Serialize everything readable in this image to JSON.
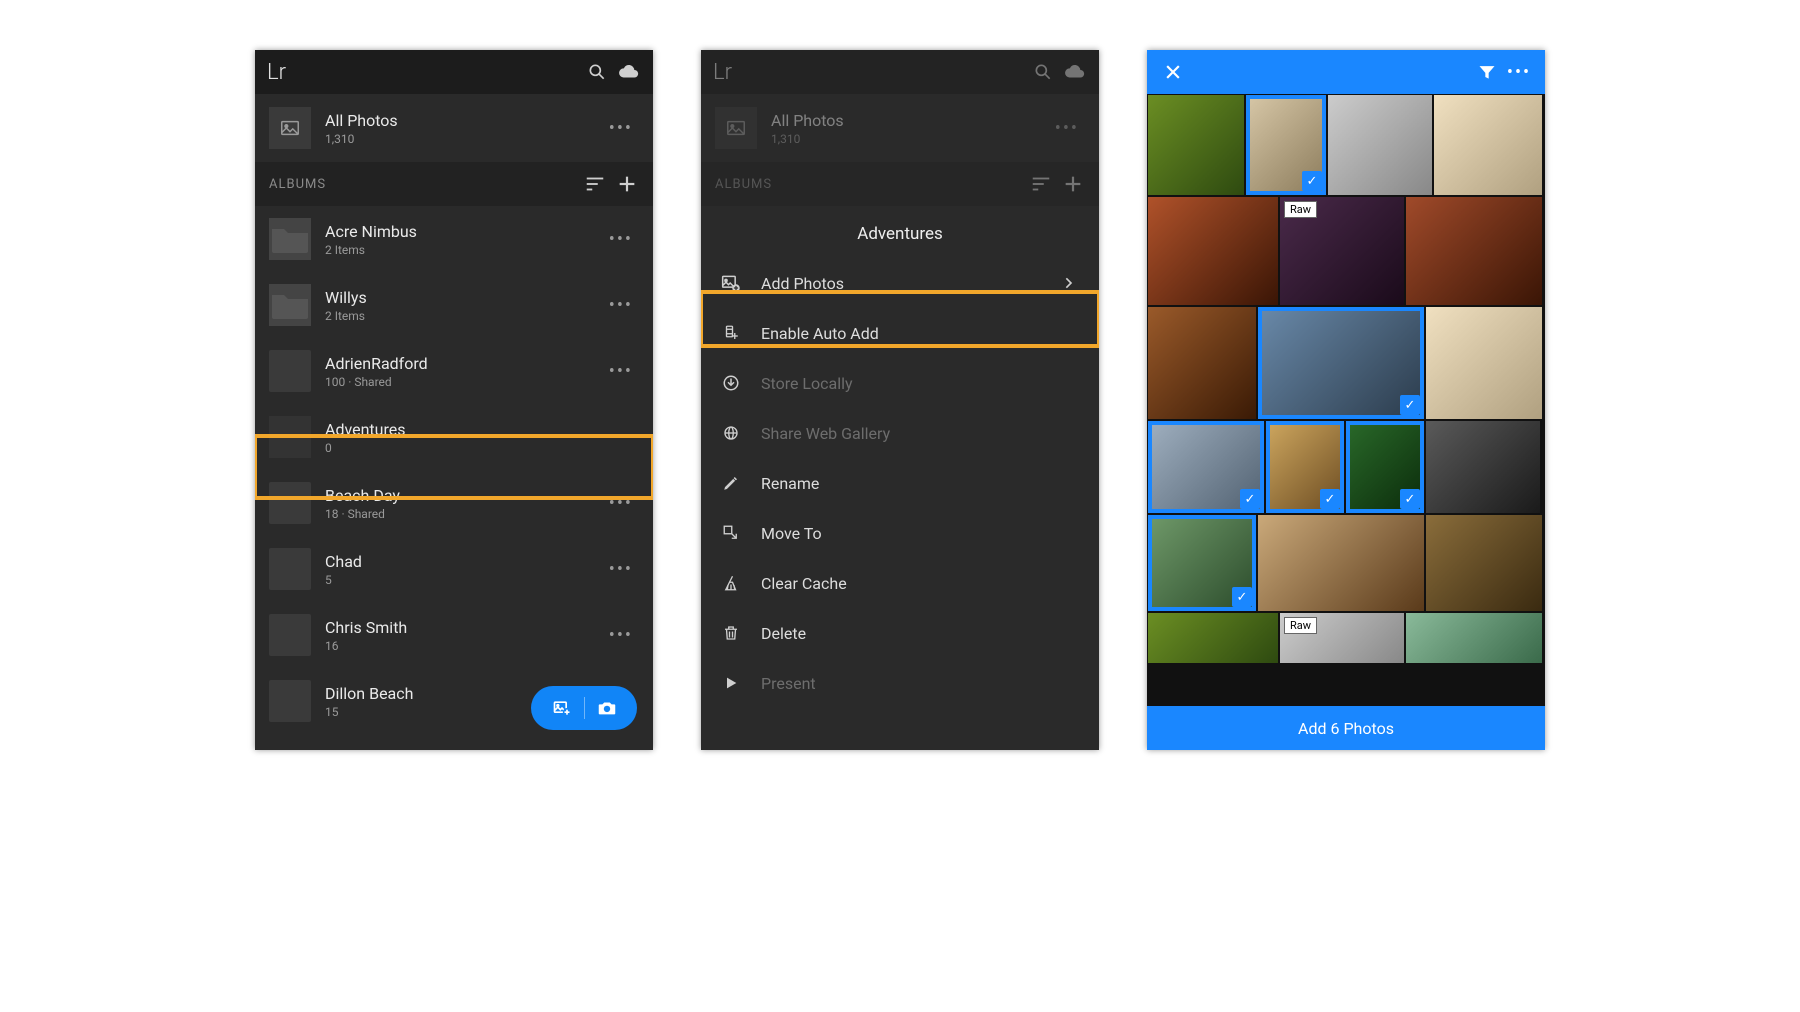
{
  "app": {
    "logo": "Lr"
  },
  "allPhotos": {
    "title": "All Photos",
    "count": "1,310"
  },
  "albumsHeader": "ALBUMS",
  "albums": [
    {
      "name": "Acre Nimbus",
      "sub": "2 Items",
      "kind": "folder"
    },
    {
      "name": "Willys",
      "sub": "2 Items",
      "kind": "folder"
    },
    {
      "name": "AdrienRadford",
      "sub": "100 · Shared",
      "kind": "photo"
    },
    {
      "name": "Adventures",
      "sub": "0",
      "kind": "empty",
      "highlighted": true
    },
    {
      "name": "Beach Day",
      "sub": "18 · Shared",
      "kind": "photo"
    },
    {
      "name": "Chad",
      "sub": "5",
      "kind": "photo"
    },
    {
      "name": "Chris Smith",
      "sub": "16",
      "kind": "photo"
    },
    {
      "name": "Dillon Beach",
      "sub": "15",
      "kind": "photo"
    }
  ],
  "contextMenu": {
    "title": "Adventures",
    "items": [
      {
        "label": "Add Photos",
        "enabled": true,
        "highlighted": true,
        "chevron": true,
        "icon": "add-photos"
      },
      {
        "label": "Enable Auto Add",
        "enabled": true,
        "icon": "auto-add"
      },
      {
        "label": "Store Locally",
        "enabled": false,
        "icon": "download"
      },
      {
        "label": "Share Web Gallery",
        "enabled": false,
        "icon": "globe"
      },
      {
        "label": "Rename",
        "enabled": true,
        "icon": "pencil"
      },
      {
        "label": "Move To",
        "enabled": true,
        "icon": "move"
      },
      {
        "label": "Clear Cache",
        "enabled": true,
        "icon": "broom"
      },
      {
        "label": "Delete",
        "enabled": true,
        "icon": "trash"
      },
      {
        "label": "Present",
        "enabled": false,
        "icon": "play"
      }
    ]
  },
  "selection": {
    "rawBadge": "Raw",
    "actionLabel": "Add 6 Photos"
  }
}
